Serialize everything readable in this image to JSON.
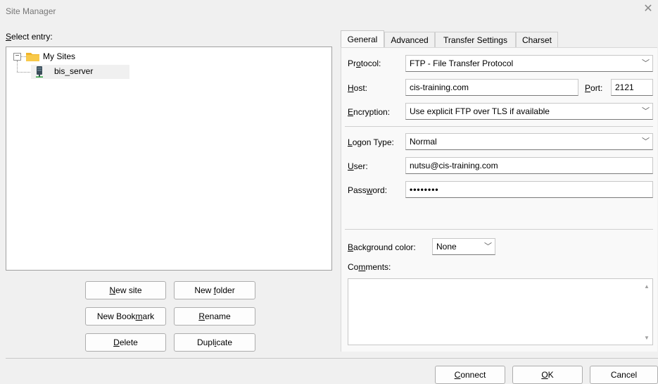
{
  "window": {
    "title": "Site Manager"
  },
  "tree": {
    "label": "Select entry:",
    "root": {
      "expander": "⊟",
      "label": "My Sites"
    },
    "child": {
      "label": "bis_server"
    }
  },
  "buttons": {
    "new_site": "New site",
    "new_folder": "New folder",
    "new_bookmark": "New Bookmark",
    "rename": "Rename",
    "delete": "Delete",
    "duplicate": "Duplicate"
  },
  "tabs": [
    "General",
    "Advanced",
    "Transfer Settings",
    "Charset"
  ],
  "general": {
    "protocol_label": "Protocol:",
    "protocol_value": "FTP - File Transfer Protocol",
    "host_label": "Host:",
    "host_value": "cis-training.com",
    "port_label": "Port:",
    "port_value": "2121",
    "encryption_label": "Encryption:",
    "encryption_value": "Use explicit FTP over TLS if available",
    "logon_label": "Logon Type:",
    "logon_value": "Normal",
    "user_label": "User:",
    "user_value": "nutsu@cis-training.com",
    "password_label": "Password:",
    "password_value": "••••••••",
    "bgcolor_label": "Background color:",
    "bgcolor_value": "None",
    "comments_label": "Comments:"
  },
  "footer": {
    "connect": "Connect",
    "ok": "OK",
    "cancel": "Cancel"
  }
}
